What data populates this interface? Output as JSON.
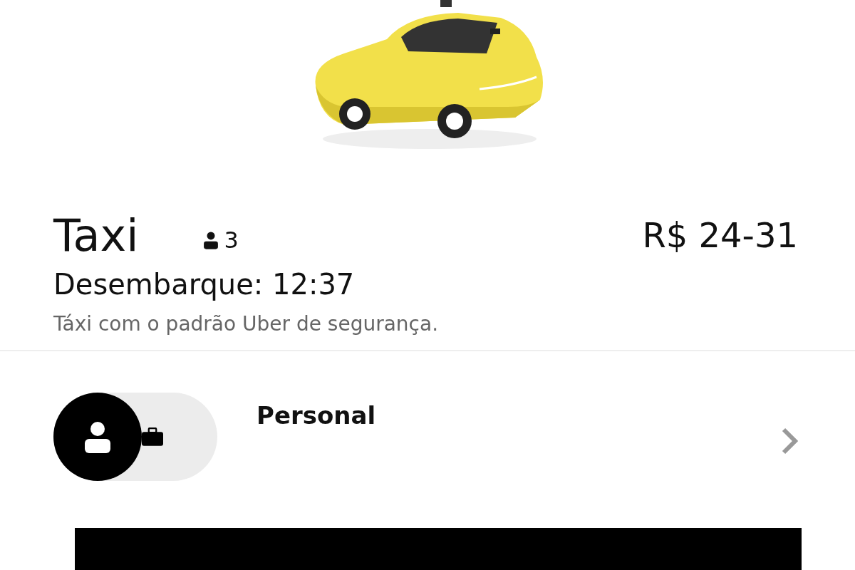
{
  "ride": {
    "title": "Taxi",
    "capacity": "3",
    "price": "R$ 24-31",
    "dropoff": "Desembarque: 12:37",
    "description": "Táxi com o padrão Uber de segurança."
  },
  "profile_toggle": [
    {
      "kind": "personal",
      "selected": true
    },
    {
      "kind": "business",
      "selected": false
    }
  ],
  "payment": {
    "label": "Personal"
  }
}
